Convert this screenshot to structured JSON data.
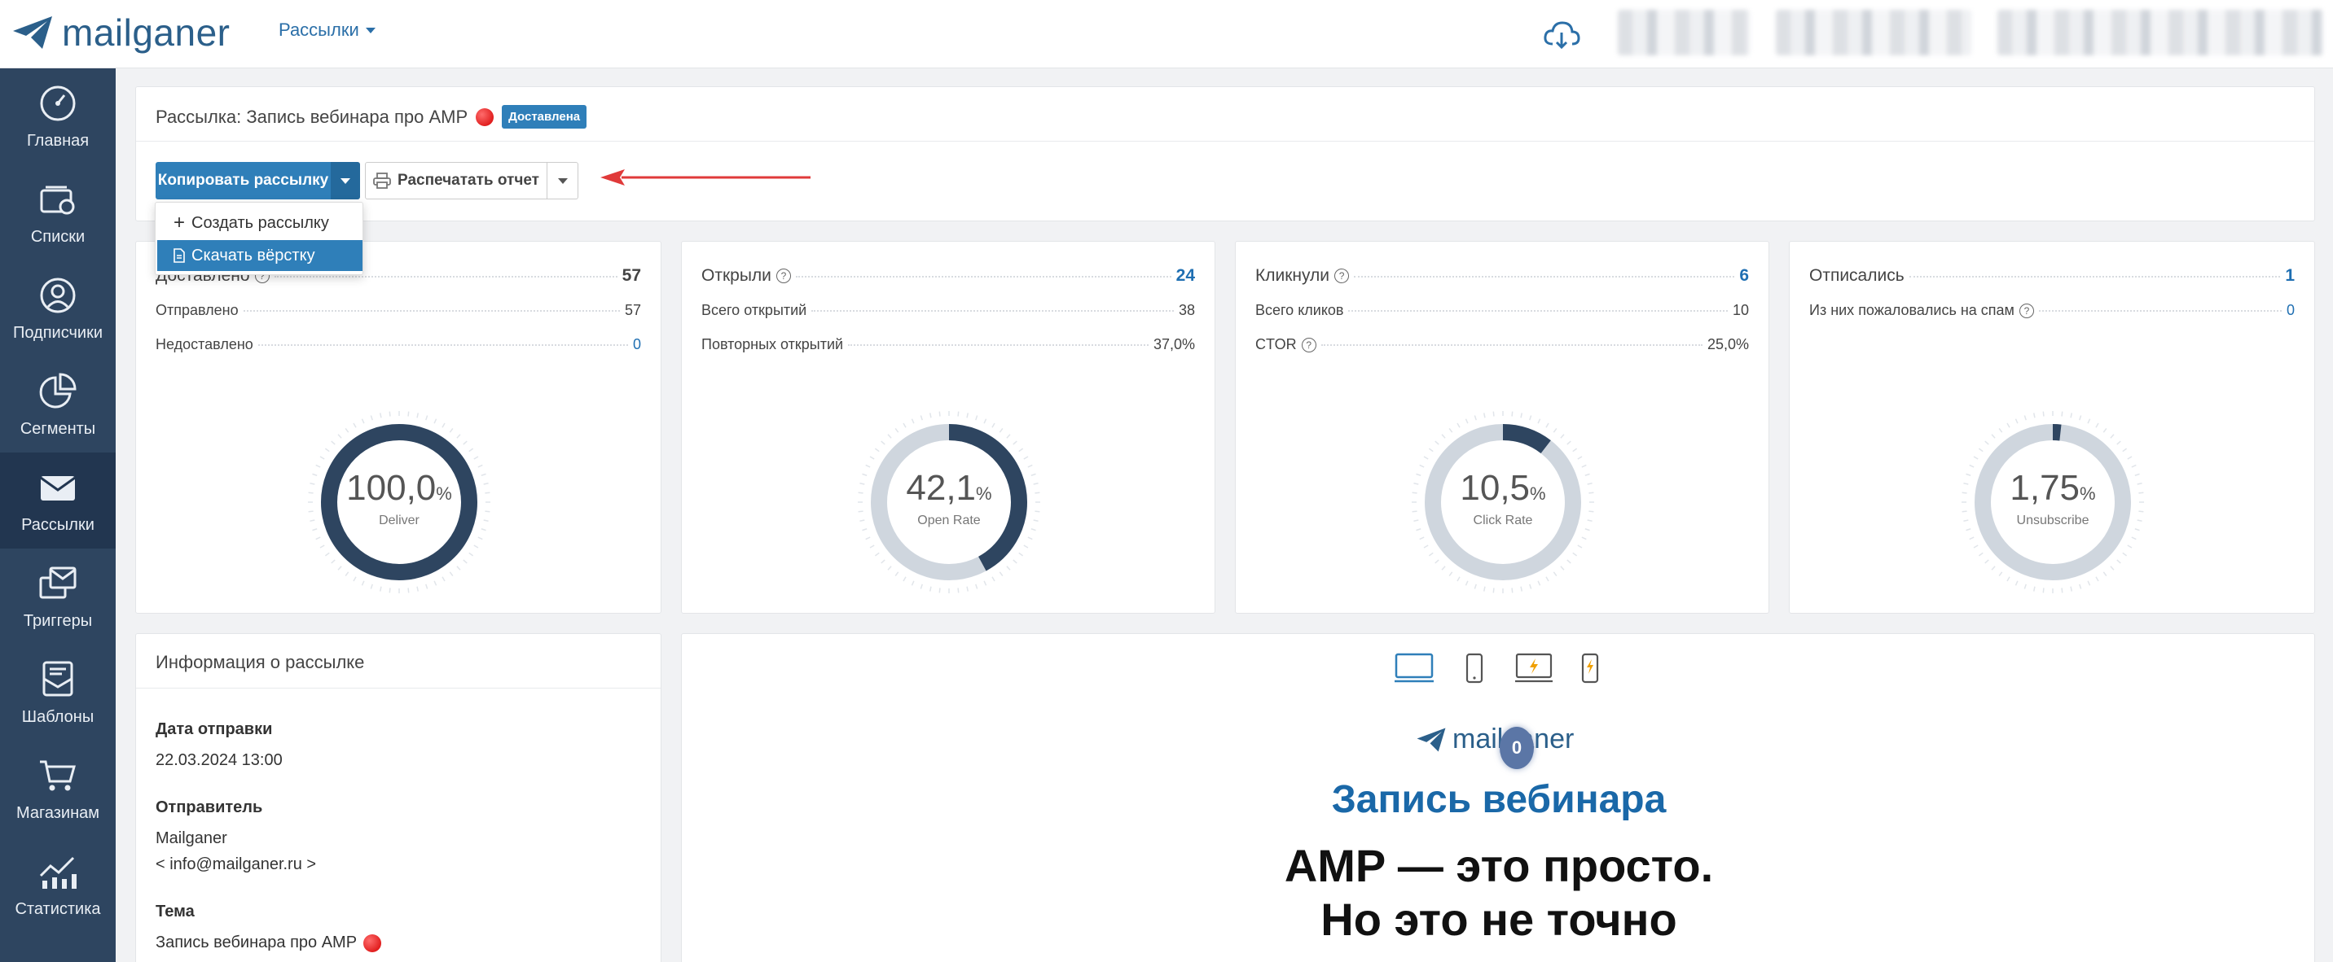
{
  "app": {
    "logo_text": "mailganer"
  },
  "topnav": {
    "menu_label": "Рассылки"
  },
  "sidebar": {
    "items": [
      {
        "label": "Главная",
        "icon": "dashboard-icon"
      },
      {
        "label": "Списки",
        "icon": "lists-icon"
      },
      {
        "label": "Подписчики",
        "icon": "subscribers-icon"
      },
      {
        "label": "Сегменты",
        "icon": "segments-icon"
      },
      {
        "label": "Рассылки",
        "icon": "mail-icon",
        "active": true
      },
      {
        "label": "Триггеры",
        "icon": "triggers-icon"
      },
      {
        "label": "Шаблоны",
        "icon": "templates-icon"
      },
      {
        "label": "Магазинам",
        "icon": "cart-icon"
      },
      {
        "label": "Статистика",
        "icon": "stats-icon"
      }
    ]
  },
  "campaign": {
    "title": "Рассылка: Запись вебинара про AMP",
    "status_badge": "Доставлена"
  },
  "toolbar": {
    "copy_label": "Копировать рассылку",
    "print_label": "Распечатать отчет",
    "dropdown": [
      {
        "label": "Создать рассылку",
        "icon": "plus-icon"
      },
      {
        "label": "Скачать вёрстку",
        "icon": "file-icon",
        "selected": true
      }
    ]
  },
  "stats": {
    "delivered": {
      "main_label": "Доставлено",
      "main_value": "57",
      "rows": [
        {
          "label": "Отправлено",
          "value": "57"
        },
        {
          "label": "Недоставлено",
          "value": "0"
        }
      ],
      "gauge_value": "100,0",
      "gauge_caption": "Deliver",
      "fraction": 1.0
    },
    "opened": {
      "main_label": "Открыли",
      "main_value": "24",
      "rows": [
        {
          "label": "Всего открытий",
          "value": "38"
        },
        {
          "label": "Повторных открытий",
          "value": "37,0%"
        }
      ],
      "gauge_value": "42,1",
      "gauge_caption": "Open Rate",
      "fraction": 0.421
    },
    "clicked": {
      "main_label": "Кликнули",
      "main_value": "6",
      "rows": [
        {
          "label": "Всего кликов",
          "value": "10"
        },
        {
          "label": "CTOR",
          "value": "25,0%"
        }
      ],
      "gauge_value": "10,5",
      "gauge_caption": "Click Rate",
      "fraction": 0.105
    },
    "unsub": {
      "main_label": "Отписались",
      "main_value": "1",
      "rows": [
        {
          "label": "Из них пожаловались на спам",
          "value": "0"
        }
      ],
      "gauge_value": "1,75",
      "gauge_caption": "Unsubscribe",
      "fraction": 0.0175
    },
    "percent_sign": "%"
  },
  "info": {
    "heading": "Информация о рассылке",
    "date_label": "Дата отправки",
    "date_value": "22.03.2024 13:00",
    "sender_label": "Отправитель",
    "sender_name": "Mailganer",
    "sender_email": "< info@mailganer.ru >",
    "subject_label": "Тема",
    "subject_value": "Запись вебинара про AMP"
  },
  "preview": {
    "logo_text": "mailganer",
    "badge": "0",
    "title": "Запись вебинара",
    "subtitle_line1": "AMP — это просто.",
    "subtitle_line2": "Но это не точно"
  },
  "colors": {
    "sidebar": "#2e4560",
    "accent": "#2f7fb9",
    "gauge_fill": "#2e4560",
    "gauge_track": "#cfd6de"
  }
}
